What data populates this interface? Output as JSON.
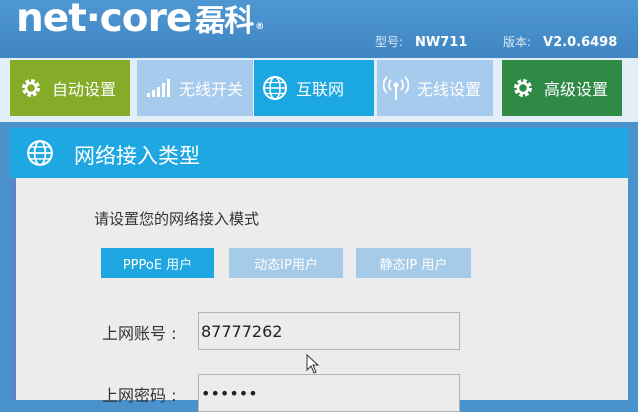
{
  "header": {
    "logo_text": "net·core",
    "logo_cn": "磊科",
    "logo_reg": "®",
    "model_label": "型号:",
    "model_value": "NW711",
    "version_label": "版本:",
    "version_value": "V2.0.6498"
  },
  "nav": [
    {
      "label": "自动设置",
      "icon": "gear-icon"
    },
    {
      "label": "无线开关",
      "icon": "signal-bars-icon"
    },
    {
      "label": "互联网",
      "icon": "globe-icon"
    },
    {
      "label": "无线设置",
      "icon": "antenna-icon"
    },
    {
      "label": "高级设置",
      "icon": "gear-icon"
    }
  ],
  "panel": {
    "title": "网络接入类型",
    "prompt": "请设置您的网络接入模式",
    "tabs": [
      {
        "label": "PPPoE 用户",
        "active": true
      },
      {
        "label": "动态IP用户",
        "active": false
      },
      {
        "label": "静态IP 用户",
        "active": false
      }
    ],
    "fields": {
      "account_label": "上网账号 :",
      "account_value": "87777262",
      "password_label": "上网密码 :",
      "password_value": "••••••"
    }
  },
  "colors": {
    "header_blue": "#4a92cc",
    "nav_auto": "#84ac29",
    "nav_inactive": "#a6cbec",
    "nav_active": "#1aa7e2",
    "nav_advanced": "#2f8a46",
    "panel_bg": "#ececec"
  }
}
